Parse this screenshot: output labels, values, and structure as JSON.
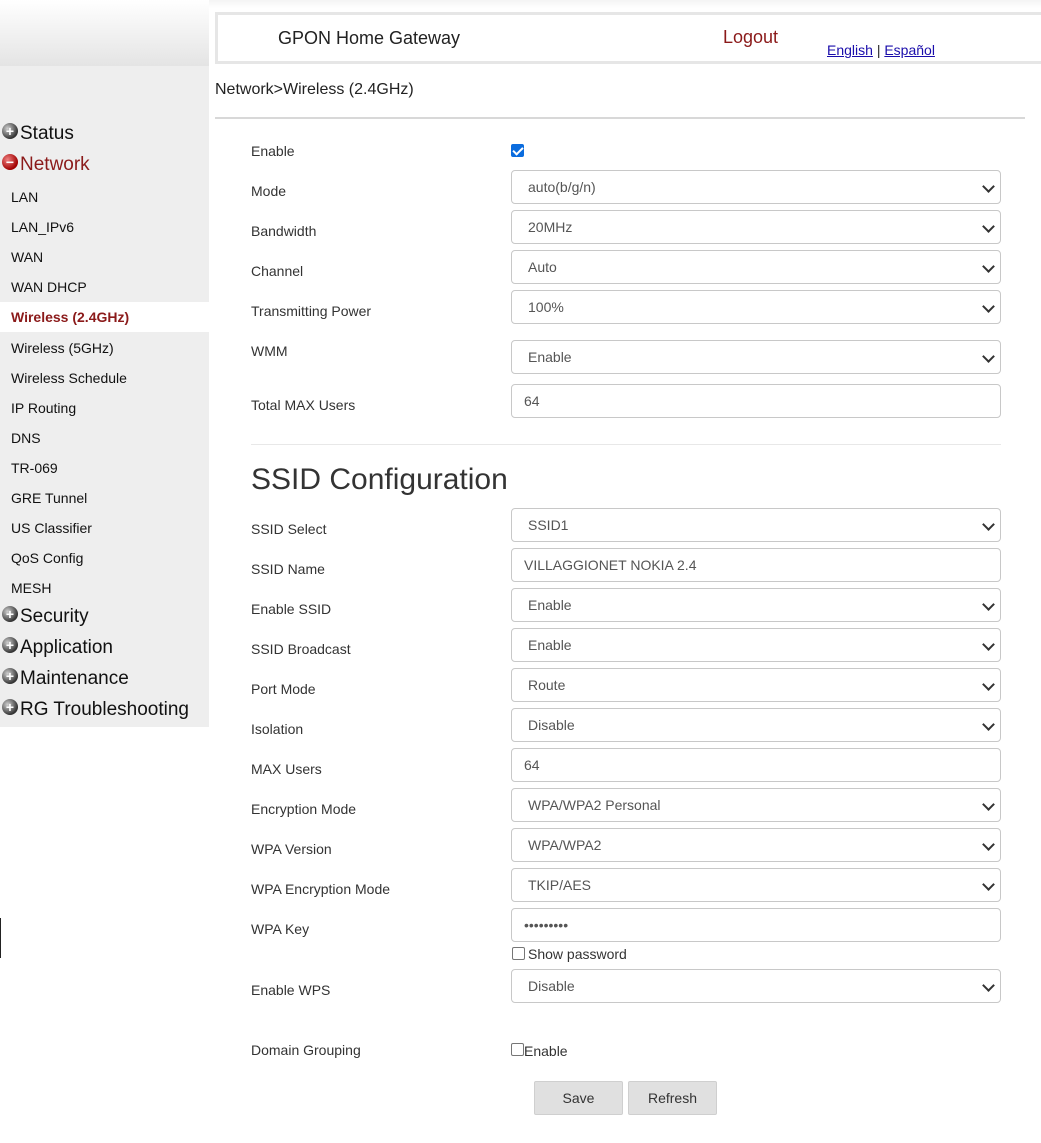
{
  "header": {
    "title": "GPON Home Gateway",
    "logout": "Logout",
    "lang_english": "English",
    "lang_separator": "|",
    "lang_espanol": "Español"
  },
  "breadcrumb": "Network>Wireless (2.4GHz)",
  "sidebar": {
    "groups": {
      "status": "Status",
      "network": "Network",
      "security": "Security",
      "application": "Application",
      "maintenance": "Maintenance",
      "rg_troubleshooting": "RG Troubleshooting"
    },
    "network_items": [
      "LAN",
      "LAN_IPv6",
      "WAN",
      "WAN DHCP",
      "Wireless (2.4GHz)",
      "Wireless (5GHz)",
      "Wireless Schedule",
      "IP Routing",
      "DNS",
      "TR-069",
      "GRE Tunnel",
      "US Classifier",
      "QoS Config",
      "MESH"
    ],
    "selected_item": "Wireless (2.4GHz)"
  },
  "wireless": {
    "enable_label": "Enable",
    "enable_checked": true,
    "mode_label": "Mode",
    "mode_value": "auto(b/g/n)",
    "bandwidth_label": "Bandwidth",
    "bandwidth_value": "20MHz",
    "channel_label": "Channel",
    "channel_value": "Auto",
    "power_label": "Transmitting Power",
    "power_value": "100%",
    "wmm_label": "WMM",
    "wmm_value": "Enable",
    "max_users_label": "Total MAX Users",
    "max_users_value": "64"
  },
  "ssid": {
    "section_title": "SSID Configuration",
    "select_label": "SSID Select",
    "select_value": "SSID1",
    "name_label": "SSID Name",
    "name_value": "VILLAGGIONET NOKIA 2.4",
    "enable_label": "Enable SSID",
    "enable_value": "Enable",
    "broadcast_label": "SSID Broadcast",
    "broadcast_value": "Enable",
    "port_mode_label": "Port Mode",
    "port_mode_value": "Route",
    "isolation_label": "Isolation",
    "isolation_value": "Disable",
    "max_users_label": "MAX Users",
    "max_users_value": "64",
    "encryption_label": "Encryption Mode",
    "encryption_value": "WPA/WPA2 Personal",
    "wpa_version_label": "WPA Version",
    "wpa_version_value": "WPA/WPA2",
    "wpa_enc_label": "WPA Encryption Mode",
    "wpa_enc_value": "TKIP/AES",
    "wpa_key_label": "WPA Key",
    "wpa_key_value": "•••••••••",
    "show_password_label": "Show password",
    "wps_label": "Enable WPS",
    "wps_value": "Disable",
    "domain_grouping_label": "Domain Grouping",
    "domain_grouping_enable": "Enable"
  },
  "buttons": {
    "save": "Save",
    "refresh": "Refresh"
  }
}
